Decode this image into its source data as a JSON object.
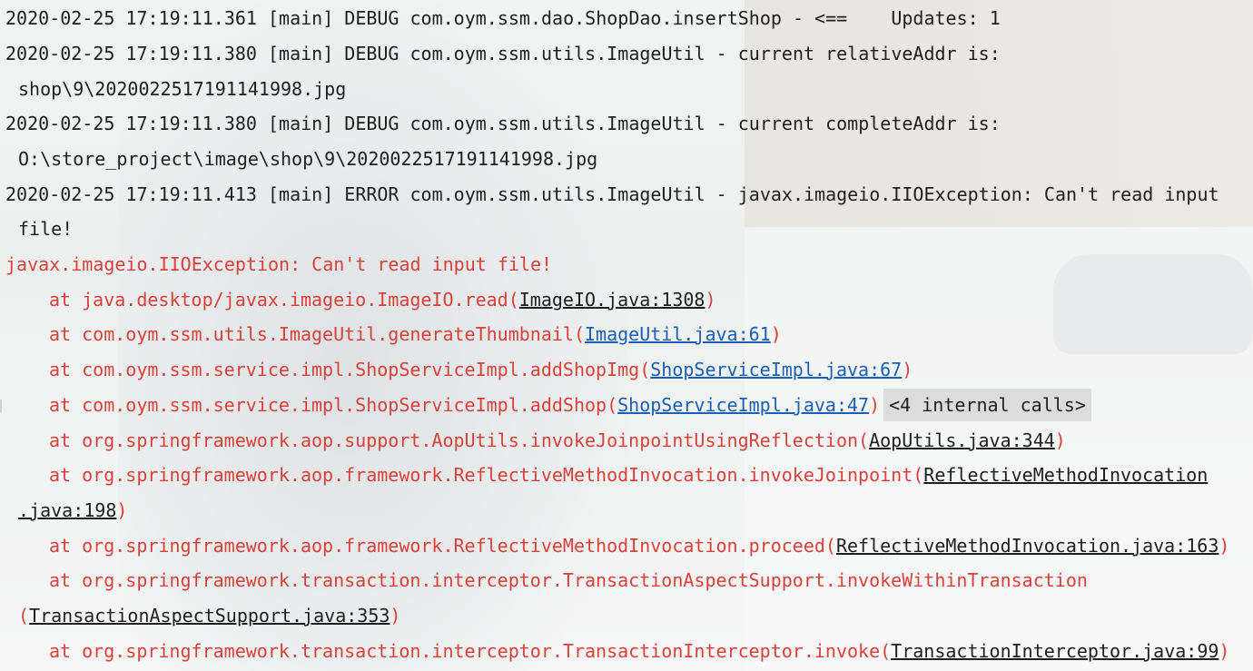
{
  "console": {
    "lines": [
      "2020-02-25 17:19:11.361 [main] DEBUG com.oym.ssm.dao.ShopDao.insertShop - <==    Updates: 1",
      "2020-02-25 17:19:11.380 [main] DEBUG com.oym.ssm.utils.ImageUtil - current relativeAddr is:",
      "shop\\9\\2020022517191141998.jpg",
      "2020-02-25 17:19:11.380 [main] DEBUG com.oym.ssm.utils.ImageUtil - current completeAddr is:",
      "O:\\store_project\\image\\shop\\9\\2020022517191141998.jpg",
      "2020-02-25 17:19:11.413 [main] ERROR com.oym.ssm.utils.ImageUtil - javax.imageio.IIOException: Can't read input",
      "file!",
      "javax.imageio.IIOException: Can't read input file!"
    ],
    "stack": [
      {
        "prefix": "at java.desktop/javax.imageio.ImageIO.read(",
        "link": "ImageIO.java:1308",
        "suffix": ")"
      },
      {
        "prefix": "at com.oym.ssm.utils.ImageUtil.generateThumbnail(",
        "link": "ImageUtil.java:61",
        "suffix": ")"
      },
      {
        "prefix": "at com.oym.ssm.service.impl.ShopServiceImpl.addShopImg(",
        "link": "ShopServiceImpl.java:67",
        "suffix": ")"
      },
      {
        "prefix": "at com.oym.ssm.service.impl.ShopServiceImpl.addShop(",
        "link": "ShopServiceImpl.java:47",
        "suffix": ")",
        "folded": "<4 internal calls>"
      },
      {
        "prefix": "at org.springframework.aop.support.AopUtils.invokeJoinpointUsingReflection(",
        "link": "AopUtils.java:344",
        "suffix": ")"
      },
      {
        "prefix": "at org.springframework.aop.framework.ReflectiveMethodInvocation.invokeJoinpoint(",
        "link": "ReflectiveMethodInvocation",
        "suffix": ""
      },
      {
        "prefix": "",
        "link": ".java:198",
        "suffix": ")"
      },
      {
        "prefix": "at org.springframework.aop.framework.ReflectiveMethodInvocation.proceed(",
        "link": "ReflectiveMethodInvocation.java:163",
        "suffix": ")"
      },
      {
        "prefix": "at org.springframework.transaction.interceptor.TransactionAspectSupport.invokeWithinTransaction",
        "link": "",
        "suffix": ""
      },
      {
        "prefix": "(",
        "link": "TransactionAspectSupport.java:353",
        "suffix": ")"
      },
      {
        "prefix": "at org.springframework.transaction.interceptor.TransactionInterceptor.invoke(",
        "link": "TransactionInterceptor.java:99",
        "suffix": ")"
      }
    ]
  },
  "colors": {
    "text": "#1f1f1f",
    "error": "#d9413b",
    "link_blue": "#1a5fb4",
    "folded_bg": "#dcdcdc"
  }
}
